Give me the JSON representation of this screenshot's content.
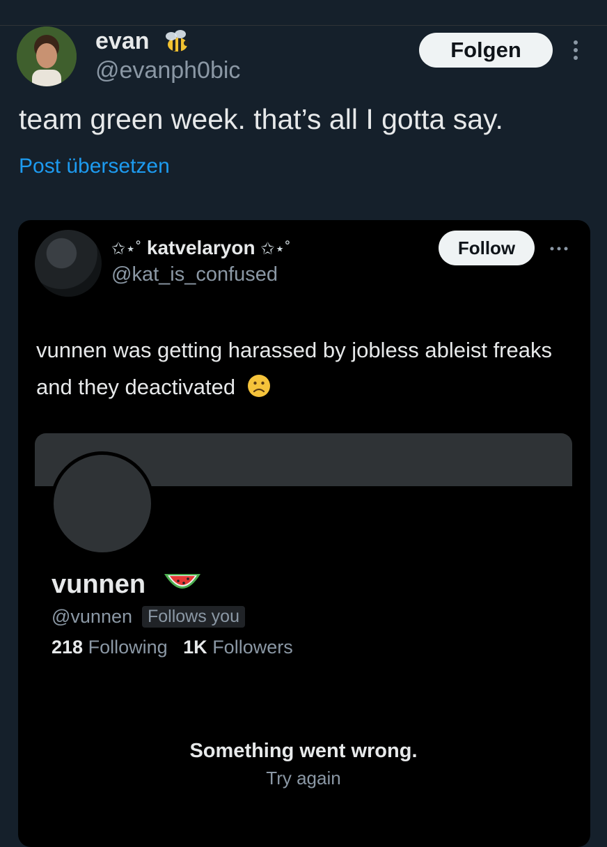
{
  "post": {
    "author_name": "evan",
    "author_handle": "@evanph0bic",
    "follow_label": "Folgen",
    "text": "team green week. that’s all I gotta say.",
    "translate_label": "Post übersetzen"
  },
  "quoted_screenshot": {
    "author_name": "katvelaryon",
    "author_handle": "@kat_is_confused",
    "follow_label": "Follow",
    "text": "vunnen was getting harassed by jobless ableist freaks and they deactivated",
    "profile": {
      "name": "vunnen",
      "handle": "@vunnen",
      "follows_badge": "Follows you",
      "following_count": "218",
      "following_label": "Following",
      "followers_count": "1K",
      "followers_label": "Followers"
    },
    "error": {
      "title": "Something went wrong.",
      "retry_label": "Try again"
    }
  },
  "icons": {
    "badge_main": "bee-icon",
    "more_main": "more-vertical-icon",
    "more_inner": "more-horizontal-icon",
    "emoji_text": "sad-face-icon",
    "emoji_name": "watermelon-icon"
  },
  "colors": {
    "background": "#15202b",
    "card_background": "#000000",
    "link": "#1d9bf0",
    "secondary_text": "#8b98a5"
  }
}
